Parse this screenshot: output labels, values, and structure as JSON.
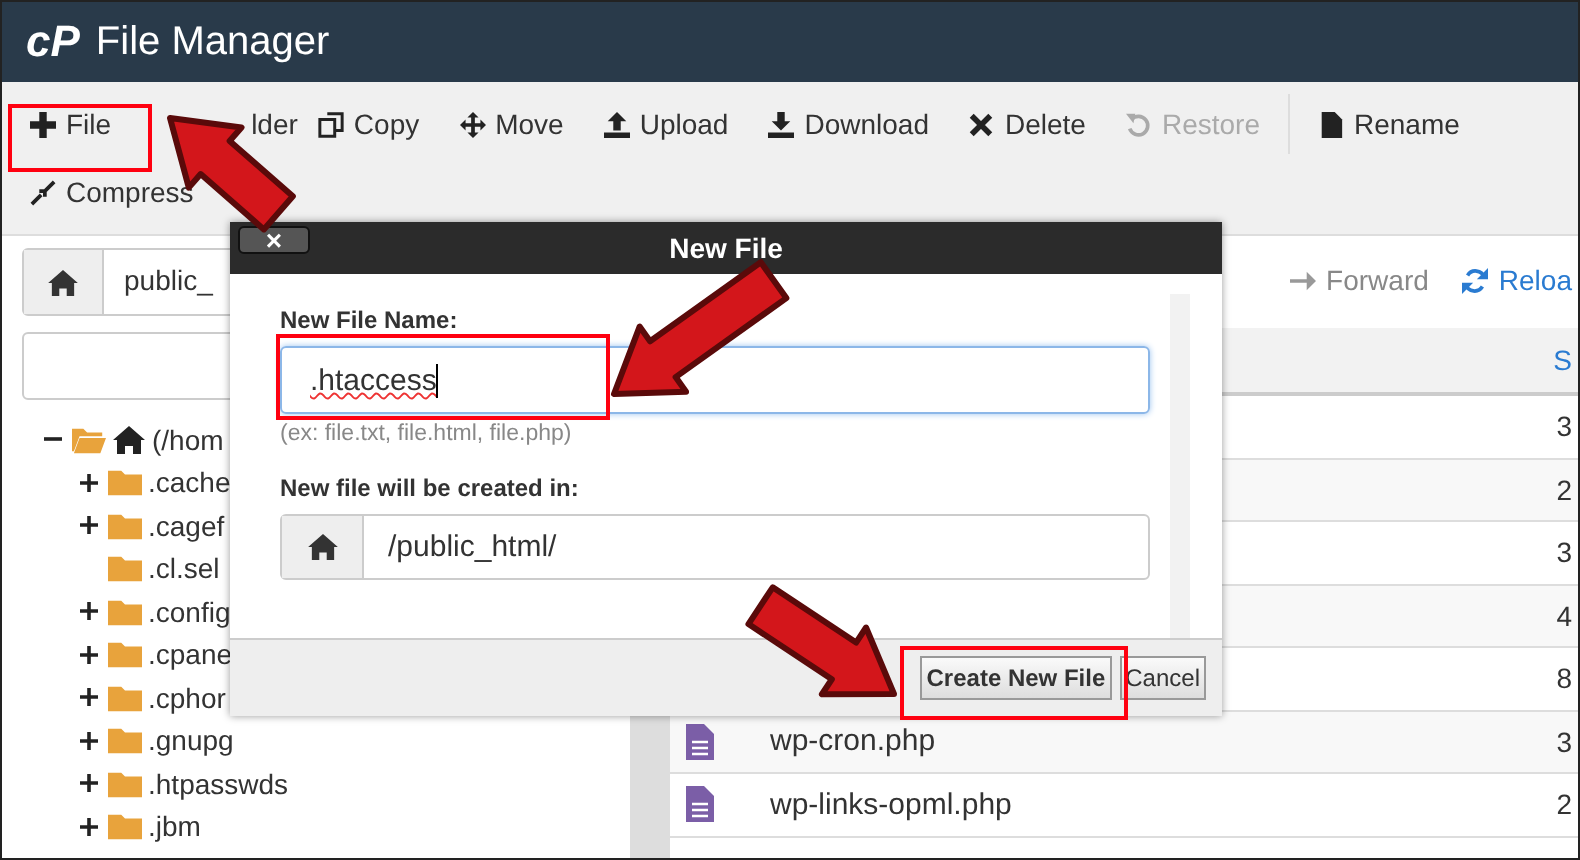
{
  "header": {
    "logo": "cP",
    "title": "File Manager"
  },
  "toolbar": [
    {
      "kind": "plus",
      "label": "File",
      "disabled": false
    },
    {
      "kind": "none",
      "label": "lder",
      "disabled": false
    },
    {
      "kind": "copy",
      "label": "Copy",
      "disabled": false
    },
    {
      "kind": "move",
      "label": "Move",
      "disabled": false
    },
    {
      "kind": "upload",
      "label": "Upload",
      "disabled": false
    },
    {
      "kind": "download",
      "label": "Download",
      "disabled": false
    },
    {
      "kind": "delete",
      "label": "Delete",
      "disabled": false
    },
    {
      "kind": "restore",
      "label": "Restore",
      "disabled": true
    },
    {
      "kind": "rename",
      "label": "Rename",
      "disabled": false
    },
    {
      "kind": "compress",
      "label": "Compress",
      "disabled": false
    }
  ],
  "path_bar": {
    "value": "public_"
  },
  "nav_buttons": [
    {
      "kind": "forward",
      "label": "Forward",
      "disabled": true
    },
    {
      "kind": "reload",
      "label": "Reloa",
      "disabled": false
    }
  ],
  "tree": [
    {
      "label": "(/hom",
      "expanded": true,
      "children": [
        {
          "label": ".cache",
          "has_children": true
        },
        {
          "label": ".cagef",
          "has_children": true
        },
        {
          "label": ".cl.sel",
          "has_children": false
        },
        {
          "label": ".config",
          "has_children": true
        },
        {
          "label": ".cpane",
          "has_children": true
        },
        {
          "label": ".cphor",
          "has_children": true
        },
        {
          "label": ".gnupg",
          "has_children": true
        },
        {
          "label": ".htpasswds",
          "has_children": true
        },
        {
          "label": ".jbm",
          "has_children": true
        }
      ]
    }
  ],
  "table": {
    "columns": [
      "S"
    ],
    "rows": [
      {
        "size": "3"
      },
      {
        "size": "2"
      },
      {
        "size": "3"
      },
      {
        "size": "4"
      },
      {
        "size": "8"
      },
      {
        "name": "wp-cron.php",
        "size": "3"
      },
      {
        "name": "wp-links-opml.php",
        "size": "2"
      }
    ]
  },
  "dialog": {
    "title": "New File",
    "close": "×",
    "name_label": "New File Name:",
    "name_value": ".htaccess",
    "hint": "(ex: file.txt, file.html, file.php)",
    "dir_label": "New file will be created in:",
    "dir_value": "/public_html/",
    "buttons": [
      {
        "kind": "primary",
        "label": "Create New File"
      },
      {
        "kind": "secondary",
        "label": "Cancel"
      }
    ]
  }
}
